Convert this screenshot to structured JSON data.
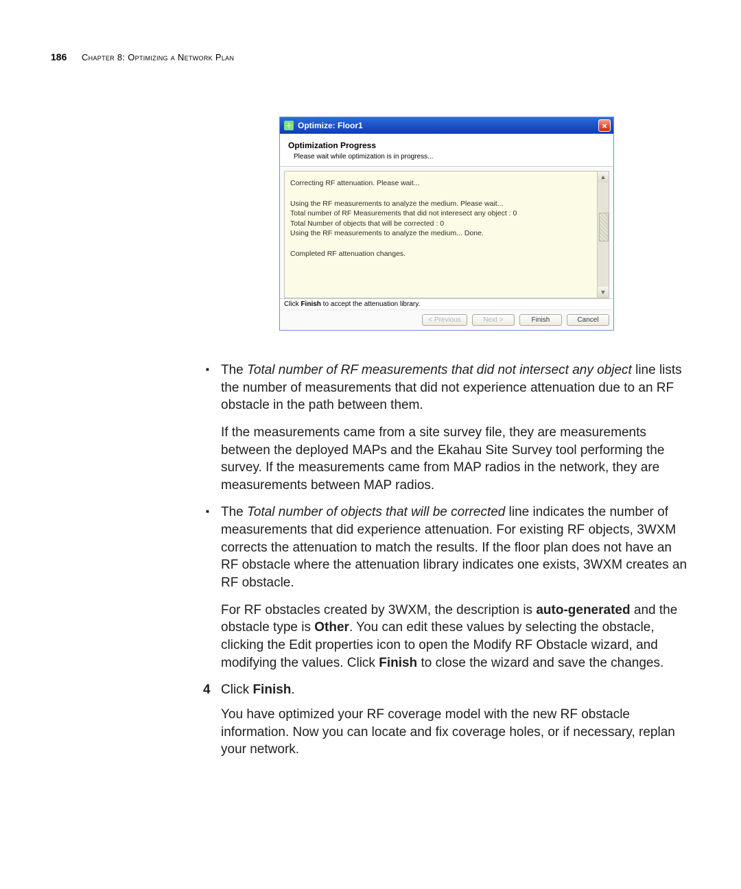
{
  "header": {
    "page_number": "186",
    "chapter_label": "Chapter 8: Optimizing a Network Plan"
  },
  "dialog": {
    "title": "Optimize: Floor1",
    "close_glyph": "×",
    "heading": "Optimization Progress",
    "subheading": "Please wait while optimization is in progress...",
    "log_line_1": "Correcting RF attenuation. Please wait...",
    "log_line_2a": "Using the RF measurements to analyze the medium. Please wait...",
    "log_line_2b": "Total number of RF Measurements that did not interesect any object : 0",
    "log_line_2c": "Total Number of objects that will be corrected : 0",
    "log_line_2d": "Using the RF measurements to analyze the medium... Done.",
    "log_line_3": "Completed RF attenuation changes.",
    "footer_note_pre": "Click ",
    "footer_note_bold": "Finish",
    "footer_note_post": " to accept the attenuation library.",
    "btn_prev": "< Previous",
    "btn_next": "Next >",
    "btn_finish": "Finish",
    "btn_cancel": "Cancel",
    "scroll_up": "▲",
    "scroll_dn": "▼"
  },
  "body": {
    "bullet1_pre": "The ",
    "bullet1_ital": "Total number of RF measurements that did not intersect any object",
    "bullet1_post": " line lists the number of measurements that did not experience attenuation due to an RF obstacle in the path between them.",
    "bullet1_p2": "If the measurements came from a site survey file, they are measurements between the deployed MAPs and the Ekahau Site Survey tool performing the survey. If the measurements came from MAP radios in the network, they are measurements between MAP radios.",
    "bullet2_pre": "The ",
    "bullet2_ital": "Total number of objects that will be corrected",
    "bullet2_post": " line indicates the number of measurements that did experience attenuation. For existing RF objects, 3WXM corrects the attenuation to match the results. If the floor plan does not have an RF obstacle where the attenuation library indicates one exists, 3WXM creates an RF obstacle.",
    "bullet2_p2_pre": "For RF obstacles created by 3WXM, the description is ",
    "bullet2_p2_bold1": "auto-generated",
    "bullet2_p2_mid": " and the obstacle type is ",
    "bullet2_p2_bold2": "Other",
    "bullet2_p2_post1": ". You can edit these values by selecting the obstacle, clicking the Edit properties icon to open the Modify RF Obstacle wizard, and modifying the values. Click ",
    "bullet2_p2_bold3": "Finish",
    "bullet2_p2_post2": " to close the wizard and save the changes.",
    "step4_num": "4",
    "step4_pre": "Click ",
    "step4_bold": "Finish",
    "step4_post": ".",
    "final_para": "You have optimized your RF coverage model with the new RF obstacle information. Now you can locate and fix coverage holes, or if necessary, replan your network."
  }
}
